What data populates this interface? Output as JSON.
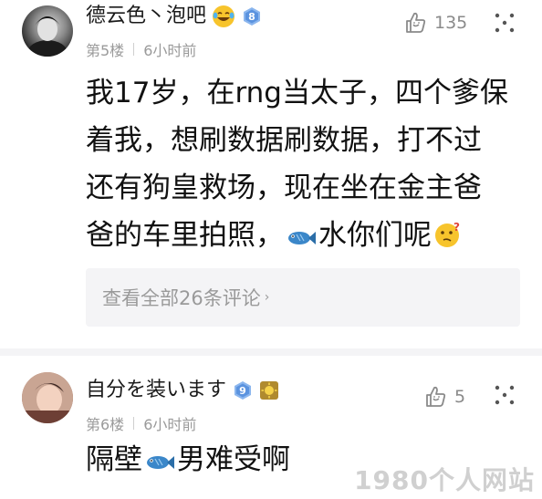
{
  "posts": [
    {
      "author": "德云色丶泡吧",
      "level": "8",
      "floor": "第5楼",
      "time": "6小时前",
      "likes": "135",
      "lines": [
        "我17岁，在rng当太子，四个爹保",
        "着我，想刷数据刷数据，打不过",
        "还有狗皇救场，现在坐在金主爸",
        "爸的车里拍照，",
        "水你们呢"
      ],
      "view_all": "查看全部26条评论"
    },
    {
      "author": "自分を装います",
      "level": "9",
      "floor": "第6楼",
      "time": "6小时前",
      "likes": "5",
      "text_before": "隔壁",
      "text_after": "男难受啊"
    }
  ],
  "watermark": "1980个人网站",
  "colors": {
    "meta": "#9a9a9a",
    "badge_blue": "#6fa8e8",
    "panel": "#f4f4f6"
  },
  "icons": {
    "laugh_emoji": "laughing-crying-emoji",
    "like": "thumbs-up-icon",
    "more": "more-dots-icon",
    "fish": "fish-icon",
    "think": "thinking-emoji",
    "sun_badge": "sun-medal-icon"
  }
}
